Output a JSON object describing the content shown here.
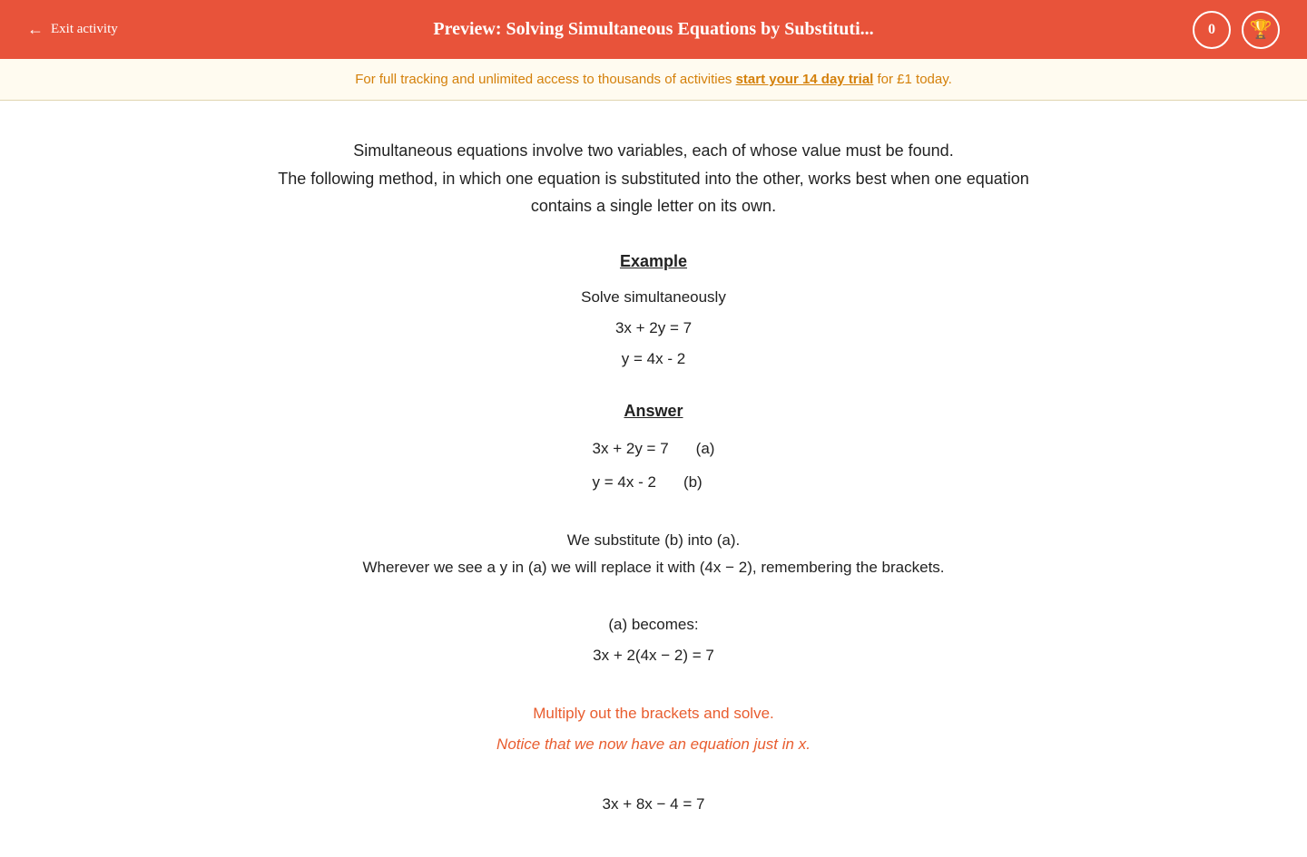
{
  "header": {
    "exit_label": "Exit activity",
    "title": "Preview: Solving Simultaneous Equations by Substituti...",
    "score": "0",
    "trophy_icon": "🏆",
    "arrow_icon": "←"
  },
  "banner": {
    "text_before": "For full tracking and unlimited access to thousands of activities ",
    "link_text": "start your 14 day trial",
    "text_after": " for £1 today."
  },
  "content": {
    "intro_line1": "Simultaneous equations involve two variables, each of whose value must be found.",
    "intro_line2": "The following method, in which one equation is substituted into the other, works best when one equation",
    "intro_line3": "contains a single letter on its own.",
    "example_heading": "Example",
    "solve_simultaneously": "Solve simultaneously",
    "eq1": "3x + 2y = 7",
    "eq2": "y = 4x - 2",
    "answer_heading": "Answer",
    "ans_eq1": "3x + 2y = 7",
    "ans_eq1_label": "(a)",
    "ans_eq2": "y = 4x - 2",
    "ans_eq2_label": "(b)",
    "substitute_line1": "We substitute (b) into (a).",
    "substitute_line2": "Wherever we see a y in (a) we will replace it with (4x − 2), remembering the brackets.",
    "becomes_label": "(a) becomes:",
    "becomes_eq": "3x + 2(4x − 2) = 7",
    "highlight1": "Multiply out the brackets and solve.",
    "highlight2": "Notice that we now have an equation just in x.",
    "final_eq1": "3x + 8x − 4 = 7"
  }
}
